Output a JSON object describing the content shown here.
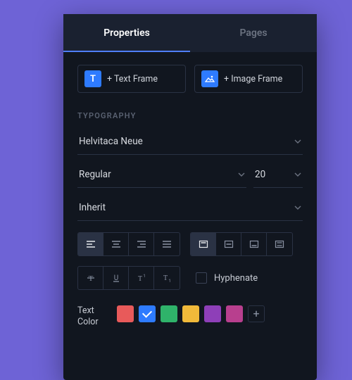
{
  "tabs": {
    "properties": "Properties",
    "pages": "Pages"
  },
  "frames": {
    "text_icon": "T",
    "text_label": "+ Text Frame",
    "image_label": "+ Image Frame"
  },
  "typography": {
    "section": "TYPOGRAPHY",
    "font_family": "Helvitaca Neue",
    "font_weight": "Regular",
    "font_size": "20",
    "line_height": "Inherit",
    "hyphenate": "Hyphenate",
    "text_color_label": "Text Color"
  },
  "colors": {
    "swatches": [
      "#e85a5a",
      "#2e7bff",
      "#2fb36a",
      "#f0b93a",
      "#8e3fb8",
      "#b83f8e"
    ],
    "active_index": 1
  }
}
